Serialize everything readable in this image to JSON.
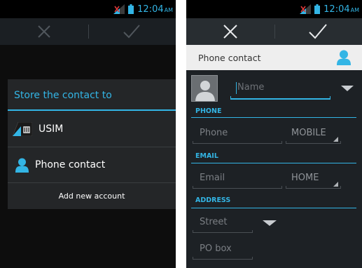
{
  "status_bar": {
    "time": "12:04",
    "ampm": "AM",
    "signal_icon": "signal-icon",
    "battery_icon": "battery-icon"
  },
  "action_bar": {
    "cancel_icon": "close-icon",
    "done_icon": "checkmark-icon"
  },
  "left_screen": {
    "dialog": {
      "title": "Store the contact to",
      "options": [
        {
          "label": "USIM",
          "icon": "sim-card-icon"
        },
        {
          "label": "Phone contact",
          "icon": "person-icon"
        }
      ],
      "add_account": "Add new account"
    }
  },
  "right_screen": {
    "account": {
      "label": "Phone contact",
      "icon": "person-icon"
    },
    "name_field": {
      "placeholder": "Name"
    },
    "sections": {
      "phone": {
        "header": "PHONE",
        "field_placeholder": "Phone",
        "type": "MOBILE"
      },
      "email": {
        "header": "EMAIL",
        "field_placeholder": "Email",
        "type": "HOME"
      },
      "address": {
        "header": "ADDRESS",
        "street_placeholder": "Street",
        "pobox_placeholder": "PO box"
      }
    }
  },
  "colors": {
    "accent": "#33b5e5",
    "background": "#1d2125",
    "dialog_background": "#242628"
  }
}
